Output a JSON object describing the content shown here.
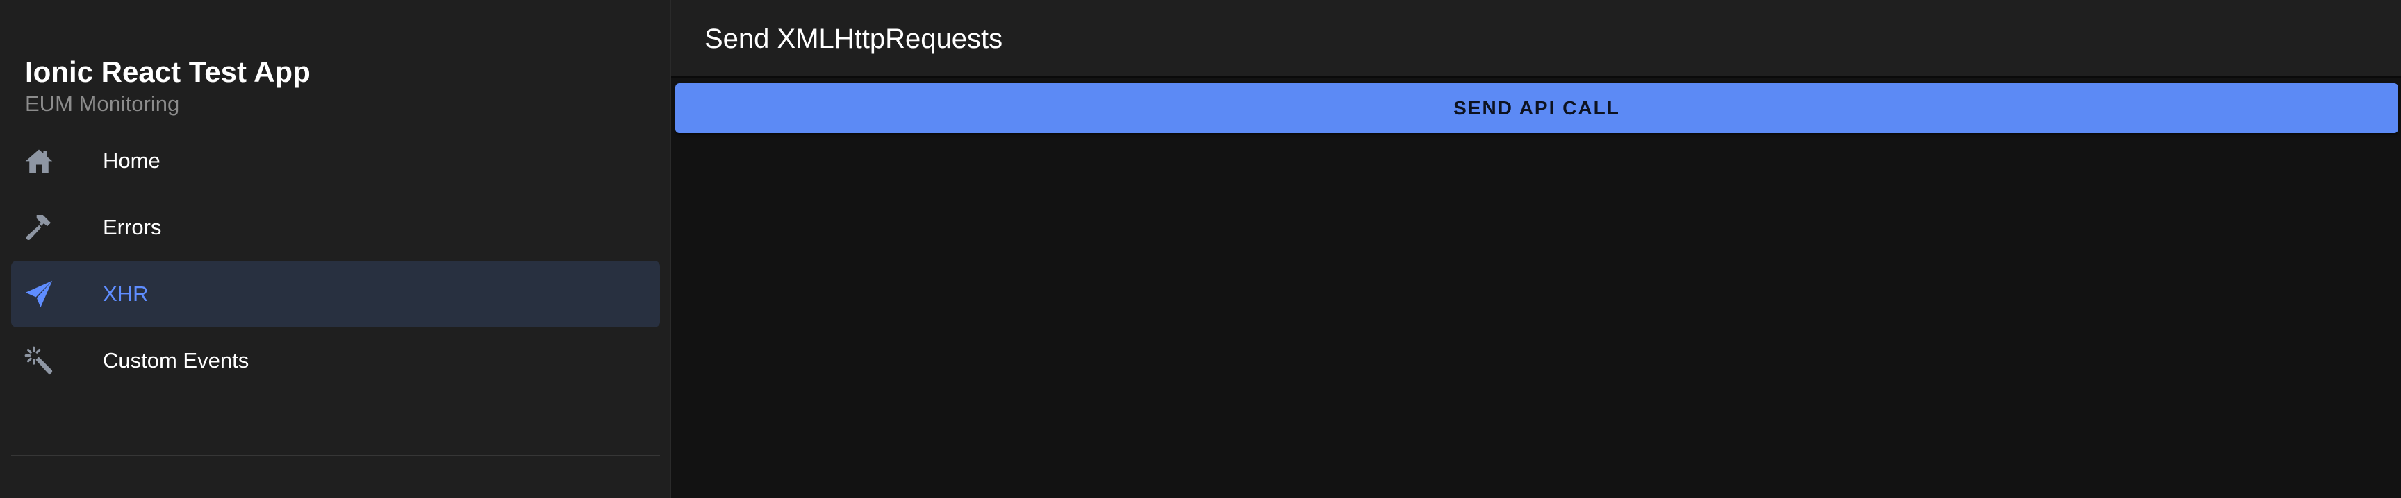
{
  "sidebar": {
    "title": "Ionic React Test App",
    "subtitle": "EUM Monitoring",
    "items": [
      {
        "label": "Home",
        "icon": "home-icon",
        "active": false
      },
      {
        "label": "Errors",
        "icon": "hammer-icon",
        "active": false
      },
      {
        "label": "XHR",
        "icon": "paper-plane-icon",
        "active": true
      },
      {
        "label": "Custom Events",
        "icon": "magic-wand-icon",
        "active": false
      }
    ]
  },
  "header": {
    "title": "Send XMLHttpRequests"
  },
  "main": {
    "send_button_label": "SEND API CALL"
  },
  "colors": {
    "accent": "#5c8af5",
    "active_label": "#5f8dff",
    "active_item_bg": "#283040",
    "sidebar_bg": "#1f1f1f",
    "content_bg": "#121212",
    "icon_inactive": "#8e96a3"
  }
}
